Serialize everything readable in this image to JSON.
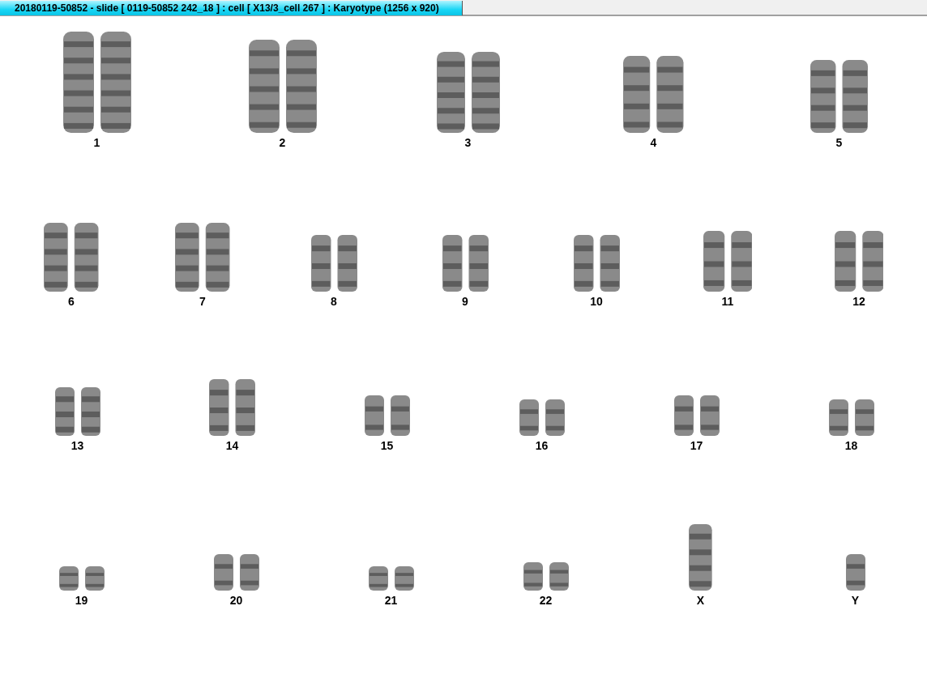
{
  "window": {
    "title": "20180119-50852 - slide [ 0119-50852 242_18 ] : cell [ X13/3_cell 267 ] : Karyotype  (1256 x 920)"
  },
  "rows": [
    {
      "items": [
        {
          "label": "1",
          "kind": "pair"
        },
        {
          "label": "2",
          "kind": "pair"
        },
        {
          "label": "3",
          "kind": "pair"
        },
        {
          "label": "4",
          "kind": "pair"
        },
        {
          "label": "5",
          "kind": "pair"
        }
      ]
    },
    {
      "items": [
        {
          "label": "6",
          "kind": "pair"
        },
        {
          "label": "7",
          "kind": "pair"
        },
        {
          "label": "8",
          "kind": "pair"
        },
        {
          "label": "9",
          "kind": "pair"
        },
        {
          "label": "10",
          "kind": "pair"
        },
        {
          "label": "11",
          "kind": "pair"
        },
        {
          "label": "12",
          "kind": "pair"
        }
      ]
    },
    {
      "items": [
        {
          "label": "13",
          "kind": "pair"
        },
        {
          "label": "14",
          "kind": "pair"
        },
        {
          "label": "15",
          "kind": "pair"
        },
        {
          "label": "16",
          "kind": "pair"
        },
        {
          "label": "17",
          "kind": "pair"
        },
        {
          "label": "18",
          "kind": "pair"
        }
      ]
    },
    {
      "items": [
        {
          "label": "19",
          "kind": "pair"
        },
        {
          "label": "20",
          "kind": "pair"
        },
        {
          "label": "21",
          "kind": "pair"
        },
        {
          "label": "22",
          "kind": "pair"
        },
        {
          "label": "X",
          "kind": "single"
        },
        {
          "label": "Y",
          "kind": "single"
        }
      ]
    }
  ]
}
